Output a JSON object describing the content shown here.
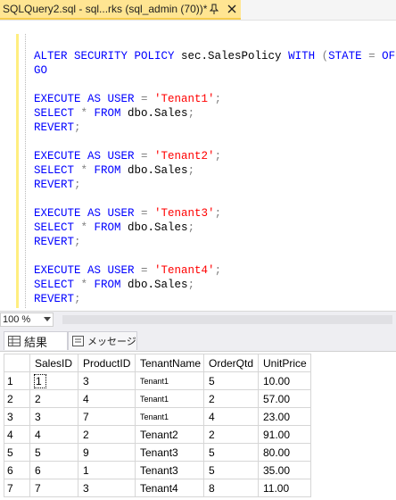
{
  "tab": {
    "title": "SQLQuery2.sql - sql...rks (sql_admin (70))*",
    "pin_icon": "pin-icon",
    "close_icon": "close-icon"
  },
  "editor": {
    "lines": [
      [
        {
          "t": "",
          "c": "tx"
        }
      ],
      [
        {
          "t": "ALTER SECURITY POLICY ",
          "c": "kw"
        },
        {
          "t": "sec.SalesPolicy ",
          "c": "tx"
        },
        {
          "t": "WITH ",
          "c": "kw"
        },
        {
          "t": "(",
          "c": "gr"
        },
        {
          "t": "STATE ",
          "c": "kw"
        },
        {
          "t": "= ",
          "c": "gr"
        },
        {
          "t": "OFF",
          "c": "kw"
        },
        {
          "t": ");",
          "c": "gr"
        }
      ],
      [
        {
          "t": "GO",
          "c": "kw"
        }
      ],
      [
        {
          "t": "",
          "c": "tx"
        }
      ],
      [
        {
          "t": "EXECUTE AS USER ",
          "c": "kw"
        },
        {
          "t": "= ",
          "c": "gr"
        },
        {
          "t": "'Tenant1'",
          "c": "st"
        },
        {
          "t": ";",
          "c": "gr"
        }
      ],
      [
        {
          "t": "SELECT ",
          "c": "kw"
        },
        {
          "t": "* ",
          "c": "gr"
        },
        {
          "t": "FROM ",
          "c": "kw"
        },
        {
          "t": "dbo.Sales",
          "c": "tx"
        },
        {
          "t": ";",
          "c": "gr"
        }
      ],
      [
        {
          "t": "REVERT",
          "c": "kw"
        },
        {
          "t": ";",
          "c": "gr"
        }
      ],
      [
        {
          "t": "",
          "c": "tx"
        }
      ],
      [
        {
          "t": "EXECUTE AS USER ",
          "c": "kw"
        },
        {
          "t": "= ",
          "c": "gr"
        },
        {
          "t": "'Tenant2'",
          "c": "st"
        },
        {
          "t": ";",
          "c": "gr"
        }
      ],
      [
        {
          "t": "SELECT ",
          "c": "kw"
        },
        {
          "t": "* ",
          "c": "gr"
        },
        {
          "t": "FROM ",
          "c": "kw"
        },
        {
          "t": "dbo.Sales",
          "c": "tx"
        },
        {
          "t": ";",
          "c": "gr"
        }
      ],
      [
        {
          "t": "REVERT",
          "c": "kw"
        },
        {
          "t": ";",
          "c": "gr"
        }
      ],
      [
        {
          "t": "",
          "c": "tx"
        }
      ],
      [
        {
          "t": "EXECUTE AS USER ",
          "c": "kw"
        },
        {
          "t": "= ",
          "c": "gr"
        },
        {
          "t": "'Tenant3'",
          "c": "st"
        },
        {
          "t": ";",
          "c": "gr"
        }
      ],
      [
        {
          "t": "SELECT ",
          "c": "kw"
        },
        {
          "t": "* ",
          "c": "gr"
        },
        {
          "t": "FROM ",
          "c": "kw"
        },
        {
          "t": "dbo.Sales",
          "c": "tx"
        },
        {
          "t": ";",
          "c": "gr"
        }
      ],
      [
        {
          "t": "REVERT",
          "c": "kw"
        },
        {
          "t": ";",
          "c": "gr"
        }
      ],
      [
        {
          "t": "",
          "c": "tx"
        }
      ],
      [
        {
          "t": "EXECUTE AS USER ",
          "c": "kw"
        },
        {
          "t": "= ",
          "c": "gr"
        },
        {
          "t": "'Tenant4'",
          "c": "st"
        },
        {
          "t": ";",
          "c": "gr"
        }
      ],
      [
        {
          "t": "SELECT ",
          "c": "kw"
        },
        {
          "t": "* ",
          "c": "gr"
        },
        {
          "t": "FROM ",
          "c": "kw"
        },
        {
          "t": "dbo.Sales",
          "c": "tx"
        },
        {
          "t": ";",
          "c": "gr"
        }
      ],
      [
        {
          "t": "REVERT",
          "c": "kw"
        },
        {
          "t": ";",
          "c": "gr"
        }
      ]
    ]
  },
  "zoom": {
    "value": "100 %",
    "dropdown_icon": "chevron-down-icon"
  },
  "results_tabs": [
    {
      "label": "結果",
      "icon": "grid-icon",
      "active": true
    },
    {
      "label": "メッセージ",
      "icon": "messages-icon",
      "active": false
    }
  ],
  "grid": {
    "columns": [
      "SalesID",
      "ProductID",
      "TenantName",
      "OrderQtd",
      "UnitPrice"
    ],
    "rows": [
      {
        "num": "1",
        "cells": [
          "1",
          "3",
          "Tenant1",
          "5",
          "10.00"
        ],
        "small_tenant": true
      },
      {
        "num": "2",
        "cells": [
          "2",
          "4",
          "Tenant1",
          "2",
          "57.00"
        ],
        "small_tenant": true
      },
      {
        "num": "3",
        "cells": [
          "3",
          "7",
          "Tenant1",
          "4",
          "23.00"
        ],
        "small_tenant": true
      },
      {
        "num": "4",
        "cells": [
          "4",
          "2",
          "Tenant2",
          "2",
          "91.00"
        ],
        "small_tenant": false
      },
      {
        "num": "5",
        "cells": [
          "5",
          "9",
          "Tenant3",
          "5",
          "80.00"
        ],
        "small_tenant": false
      },
      {
        "num": "6",
        "cells": [
          "6",
          "1",
          "Tenant3",
          "5",
          "35.00"
        ],
        "small_tenant": false
      },
      {
        "num": "7",
        "cells": [
          "7",
          "3",
          "Tenant4",
          "8",
          "11.00"
        ],
        "small_tenant": false
      }
    ]
  },
  "colors": {
    "tab_active": "#ffe592",
    "keyword": "#0000ff",
    "string": "#ff0000",
    "operator": "#808080",
    "modified_bar": "#ffee80"
  }
}
